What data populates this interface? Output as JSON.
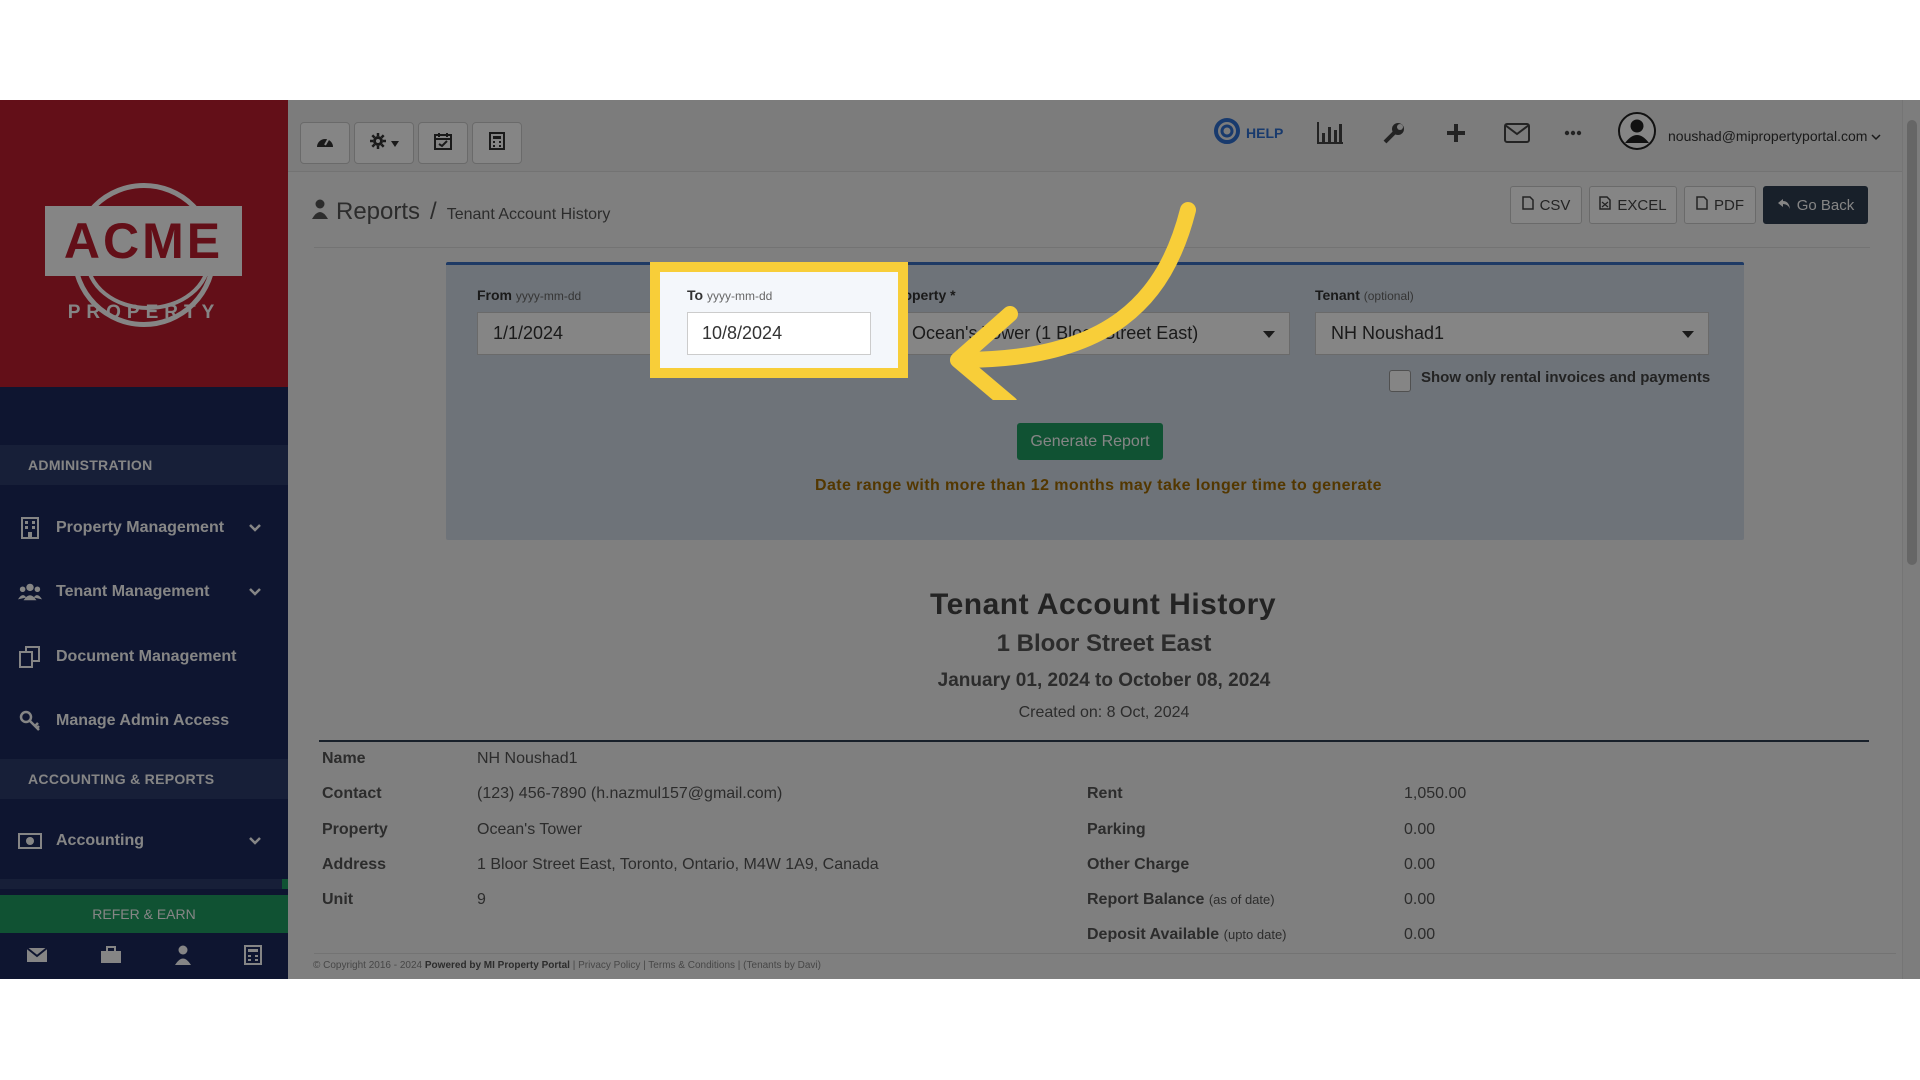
{
  "sidebar": {
    "logo_text": "ACME",
    "logo_sub": "PROPERTY",
    "sections": [
      "ADMINISTRATION",
      "ACCOUNTING & REPORTS"
    ],
    "items": [
      {
        "label": "Property Management",
        "icon": "building-icon"
      },
      {
        "label": "Tenant Management",
        "icon": "users-icon"
      },
      {
        "label": "Document Management",
        "icon": "documents-icon"
      },
      {
        "label": "Manage Admin Access",
        "icon": "key-icon"
      },
      {
        "label": "Accounting",
        "icon": "money-icon"
      }
    ],
    "refer_label": "REFER & EARN",
    "footer_icons": [
      "mail-icon",
      "briefcase-icon",
      "user-icon",
      "calculator-icon"
    ]
  },
  "topbar": {
    "left_icons": [
      "dashboard-icon",
      "settings-icon",
      "calendar-check-icon",
      "calculator-icon"
    ],
    "help_label": "HELP",
    "right_icons": [
      "bar-chart-icon",
      "wrench-icon",
      "plus-icon",
      "mail-icon",
      "more-icon"
    ],
    "user_email": "noushad@mipropertyportal.com"
  },
  "page": {
    "title": "Reports",
    "separator": "/",
    "breadcrumb": "Tenant Account History",
    "actions": [
      "CSV",
      "EXCEL",
      "PDF",
      "Go Back"
    ]
  },
  "form": {
    "from_label": "From",
    "from_hint": "yyyy-mm-dd",
    "from_value": "1/1/2024",
    "to_label": "To",
    "to_hint": "yyyy-mm-dd",
    "to_value": "10/8/2024",
    "property_label": "roperty *",
    "property_value": "Ocean's Tower (1 Bloor Street East)",
    "tenant_label": "Tenant",
    "tenant_hint": "(optional)",
    "tenant_value": "NH Noushad1",
    "checkbox_label": "Show only rental invoices and payments",
    "generate_label": "Generate Report",
    "note": "Date range with more than 12 months may take longer time to generate"
  },
  "report": {
    "title": "Tenant Account History",
    "subtitle": "1 Bloor Street East",
    "range": "January 01, 2024 to October 08, 2024",
    "created": "Created on: 8 Oct, 2024",
    "left": [
      {
        "k": "Name",
        "v": "NH Noushad1"
      },
      {
        "k": "Contact",
        "v": "(123) 456-7890 (h.nazmul157@gmail.com)"
      },
      {
        "k": "Property",
        "v": "Ocean's Tower"
      },
      {
        "k": "Address",
        "v": "1 Bloor Street East, Toronto, Ontario, M4W 1A9, Canada"
      },
      {
        "k": "Unit",
        "v": "9"
      }
    ],
    "right": [
      {
        "k": "Rent",
        "note": "",
        "v": "1,050.00"
      },
      {
        "k": "Parking",
        "note": "",
        "v": "0.00"
      },
      {
        "k": "Other Charge",
        "note": "",
        "v": "0.00"
      },
      {
        "k": "Report Balance",
        "note": "(as of date)",
        "v": "0.00"
      },
      {
        "k": "Deposit Available",
        "note": "(upto date)",
        "v": "0.00"
      }
    ]
  },
  "footer": {
    "copyright": "© Copyright 2016 - 2024",
    "powered": "Powered by MI Property Portal",
    "links": "| Privacy Policy | Terms & Conditions |",
    "small": "(Tenants by Davi)"
  },
  "colors": {
    "brand_red": "#bf1e2e",
    "sidebar_navy": "#1b2a5c",
    "accent_green": "#1f9e63",
    "highlight_yellow": "#f8ce39"
  }
}
